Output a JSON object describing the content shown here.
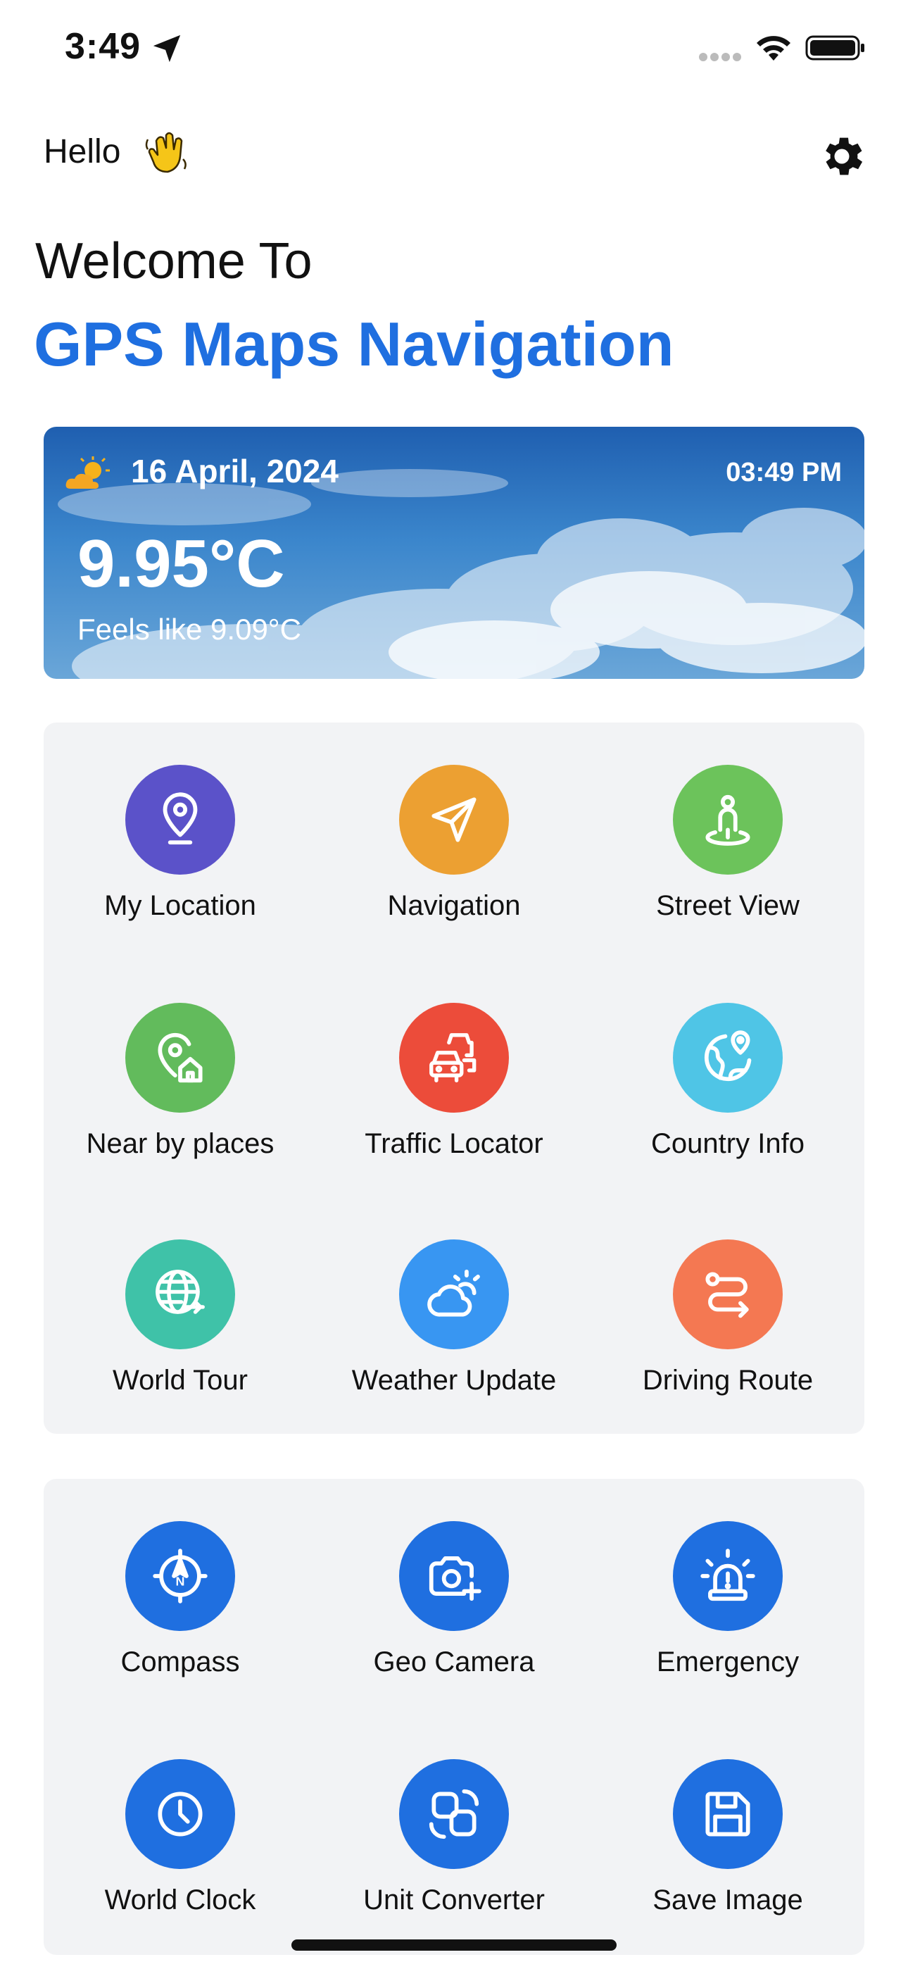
{
  "status_bar": {
    "time": "3:49"
  },
  "header": {
    "greeting": "Hello",
    "welcome": "Welcome To",
    "app_name": "GPS Maps Navigation"
  },
  "weather": {
    "date": "16 April, 2024",
    "time": "03:49 PM",
    "temperature": "9.95°C",
    "feels_like": "Feels like 9.09°C"
  },
  "features": [
    {
      "label": "My Location",
      "icon": "location-pin-icon",
      "color": "#5b52c9"
    },
    {
      "label": "Navigation",
      "icon": "navigation-arrow-icon",
      "color": "#eca032"
    },
    {
      "label": "Street View",
      "icon": "street-view-person-icon",
      "color": "#6cc35b"
    },
    {
      "label": "Near by places",
      "icon": "nearby-home-pin-icon",
      "color": "#62bb5c"
    },
    {
      "label": "Traffic Locator",
      "icon": "traffic-cars-icon",
      "color": "#ec4c3a"
    },
    {
      "label": "Country Info",
      "icon": "globe-pin-icon",
      "color": "#4fc5e6"
    },
    {
      "label": "World Tour",
      "icon": "world-tour-globe-icon",
      "color": "#3fc2a8"
    },
    {
      "label": "Weather Update",
      "icon": "weather-cloud-sun-icon",
      "color": "#3896f2"
    },
    {
      "label": "Driving Route",
      "icon": "route-icon",
      "color": "#f47852"
    }
  ],
  "tools": [
    {
      "label": "Compass",
      "icon": "compass-icon",
      "color": "#1f6fe0"
    },
    {
      "label": "Geo Camera",
      "icon": "camera-icon",
      "color": "#1f6fe0"
    },
    {
      "label": "Emergency",
      "icon": "emergency-siren-icon",
      "color": "#1f6fe0"
    },
    {
      "label": "World Clock",
      "icon": "clock-icon",
      "color": "#1f6fe0"
    },
    {
      "label": "Unit Converter",
      "icon": "convert-icon",
      "color": "#1f6fe0"
    },
    {
      "label": "Save Image",
      "icon": "save-floppy-icon",
      "color": "#1f6fe0"
    }
  ]
}
